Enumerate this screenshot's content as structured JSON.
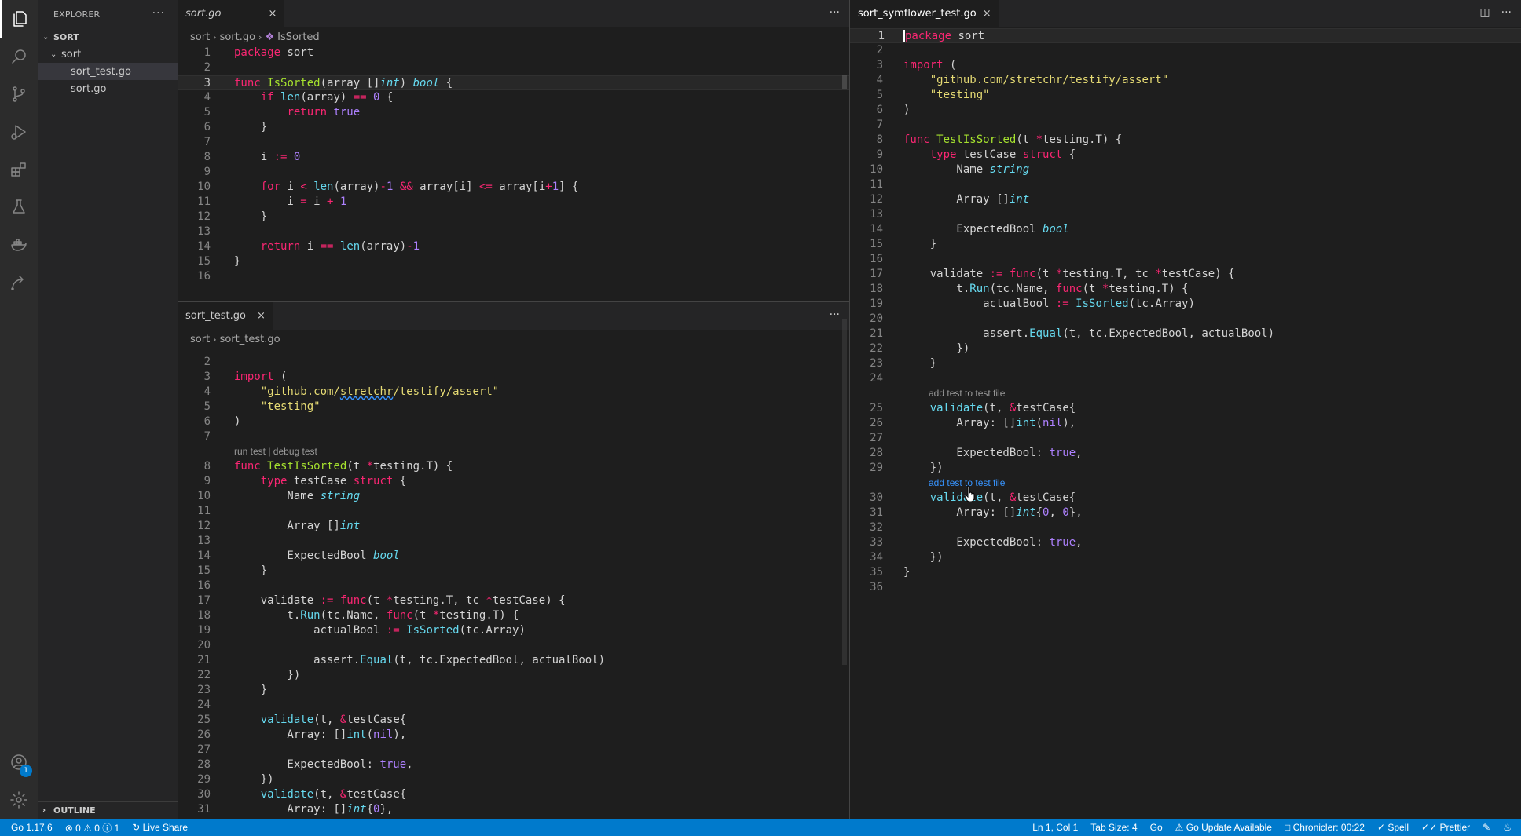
{
  "sidebar": {
    "header": "EXPLORER",
    "more": "···",
    "section": "SORT",
    "folder": "sort",
    "files": [
      "sort_test.go",
      "sort.go"
    ],
    "outline": "OUTLINE"
  },
  "activity": {
    "account_badge": "1"
  },
  "group1": {
    "tab": "sort.go",
    "close": "×",
    "more": "···",
    "breadcrumb": [
      "sort",
      "sort.go",
      "IsSorted"
    ]
  },
  "group2": {
    "tab": "sort_test.go",
    "close": "×",
    "more": "···",
    "breadcrumb": [
      "sort",
      "sort_test.go"
    ],
    "codelens": "run test | debug test"
  },
  "group3": {
    "tab": "sort_symflower_test.go",
    "close": "×",
    "more": "···",
    "codelens": "add test to test file"
  },
  "statusbar": {
    "go_version": "Go 1.17.6",
    "problems": "⊗ 0 ⚠ 0 ⓘ 1",
    "live_share": "Live Share",
    "position": "Ln 1, Col 1",
    "tab_size": "Tab Size: 4",
    "language": "Go",
    "go_update": "Go Update Available",
    "chronicler": "Chronicler: 00:22",
    "spell": "Spell",
    "prettier": "Prettier"
  },
  "colors": {
    "statusbar": "#007acc",
    "editor": "#1e1e1e",
    "sidebar": "#252526",
    "activity": "#2c2c2c"
  },
  "icons": [
    "files-icon",
    "search-icon",
    "source-control-icon",
    "run-debug-icon",
    "extensions-icon",
    "testing-icon",
    "docker-icon",
    "remote-icon",
    "account-icon",
    "settings-gear-icon"
  ]
}
